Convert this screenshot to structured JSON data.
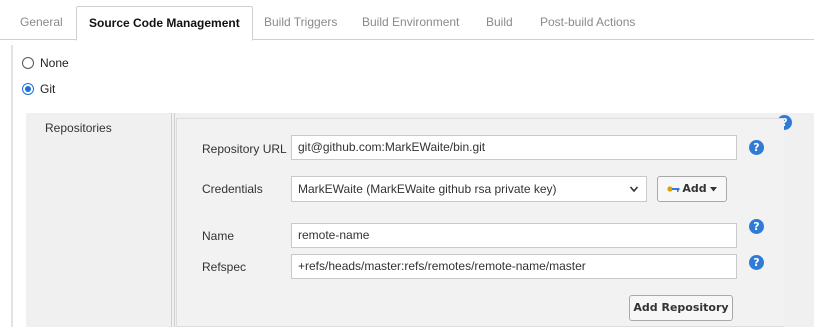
{
  "tabs": [
    {
      "label": "General",
      "active": false
    },
    {
      "label": "Source Code Management",
      "active": true
    },
    {
      "label": "Build Triggers",
      "active": false
    },
    {
      "label": "Build Environment",
      "active": false
    },
    {
      "label": "Build",
      "active": false
    },
    {
      "label": "Post-build Actions",
      "active": false
    }
  ],
  "scm": {
    "options": [
      {
        "label": "None",
        "selected": false
      },
      {
        "label": "Git",
        "selected": true
      }
    ]
  },
  "repositories": {
    "section_label": "Repositories",
    "url_label": "Repository URL",
    "url_value": "git@github.com:MarkEWaite/bin.git",
    "credentials_label": "Credentials",
    "credentials_value": "MarkEWaite (MarkEWaite github rsa private key)",
    "add_button_label": "Add",
    "name_label": "Name",
    "name_value": "remote-name",
    "refspec_label": "Refspec",
    "refspec_value": "+refs/heads/master:refs/remotes/remote-name/master",
    "add_repository_label": "Add Repository"
  },
  "icons": {
    "help": "question-mark-icon",
    "key": "key-icon",
    "caret": "chevron-down-icon"
  },
  "help_glyph": "?",
  "colors": {
    "accent": "#2f7bd6",
    "radio_selected": "#1e6fd9",
    "panel_background": "#f0f0f0",
    "border": "#c9c9c9"
  }
}
